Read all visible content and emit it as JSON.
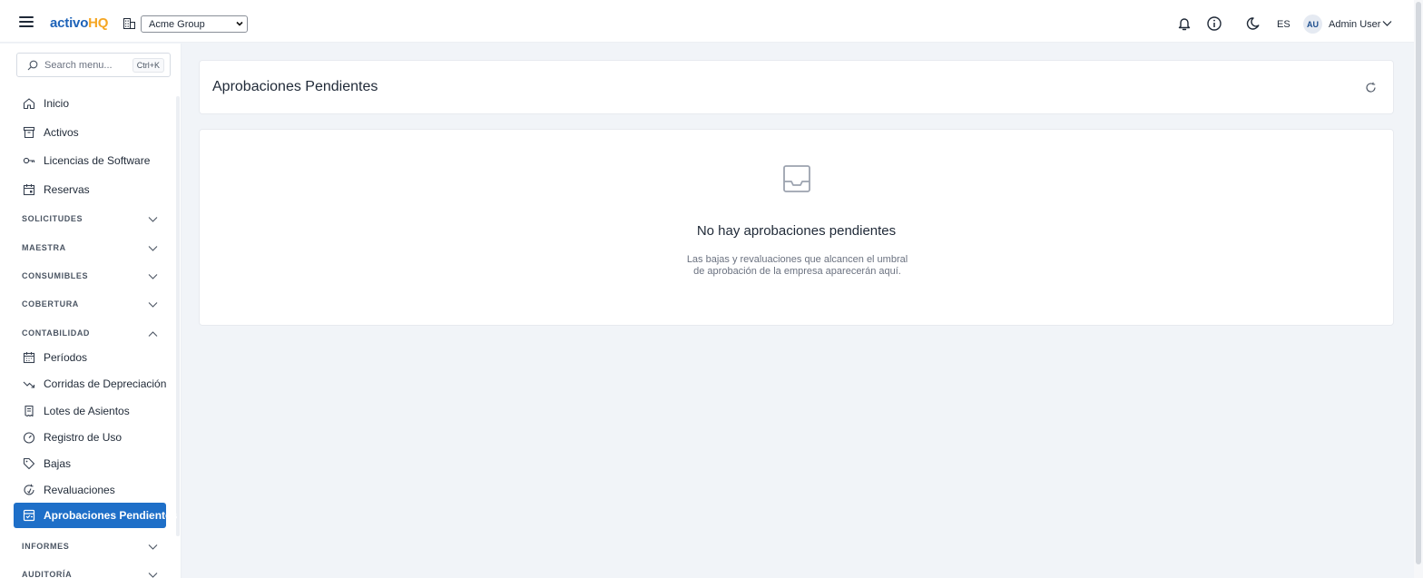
{
  "header": {
    "brand_part1": "activo",
    "brand_part2": "HQ",
    "org_selected": "Acme Group",
    "language": "ES",
    "user_initials": "AU",
    "user_name": "Admin User",
    "icons": [
      "menu-icon",
      "building-icon",
      "bell-icon",
      "info-icon",
      "moon-icon",
      "chevron-down-icon"
    ]
  },
  "sidebar": {
    "search_placeholder": "Search menu...",
    "search_shortcut": "Ctrl+K",
    "top_items": [
      {
        "label": "Inicio",
        "icon": "home-icon"
      },
      {
        "label": "Activos",
        "icon": "archive-icon"
      },
      {
        "label": "Licencias de Software",
        "icon": "key-icon"
      },
      {
        "label": "Reservas",
        "icon": "calendar-icon"
      }
    ],
    "sections": [
      {
        "label": "SOLICITUDES",
        "expanded": false
      },
      {
        "label": "MAESTRA",
        "expanded": false
      },
      {
        "label": "CONSUMIBLES",
        "expanded": false
      },
      {
        "label": "COBERTURA",
        "expanded": false
      },
      {
        "label": "CONTABILIDAD",
        "expanded": true
      },
      {
        "label": "INFORMES",
        "expanded": false
      },
      {
        "label": "AUDITORÍA",
        "expanded": false
      }
    ],
    "contabilidad_items": [
      {
        "label": "Períodos",
        "icon": "calendar-grid-icon"
      },
      {
        "label": "Corridas de Depreciación",
        "icon": "trending-down-icon"
      },
      {
        "label": "Lotes de Asientos",
        "icon": "receipt-icon"
      },
      {
        "label": "Registro de Uso",
        "icon": "gauge-icon"
      },
      {
        "label": "Bajas",
        "icon": "tag-icon"
      },
      {
        "label": "Revaluaciones",
        "icon": "refresh-dollar-icon"
      },
      {
        "label": "Aprobaciones Pendientes",
        "icon": "approval-icon",
        "active": true
      }
    ]
  },
  "main": {
    "title": "Aprobaciones Pendientes",
    "empty_title": "No hay aprobaciones pendientes",
    "empty_desc_line1": "Las bajas y revaluaciones que alcancen el umbral",
    "empty_desc_line2": "de aprobación de la empresa aparecerán aquí."
  },
  "colors": {
    "brand_blue": "#1e63b8",
    "brand_orange": "#f5a623",
    "active_nav": "#1e6fc8",
    "page_bg": "#f1f4f8"
  }
}
